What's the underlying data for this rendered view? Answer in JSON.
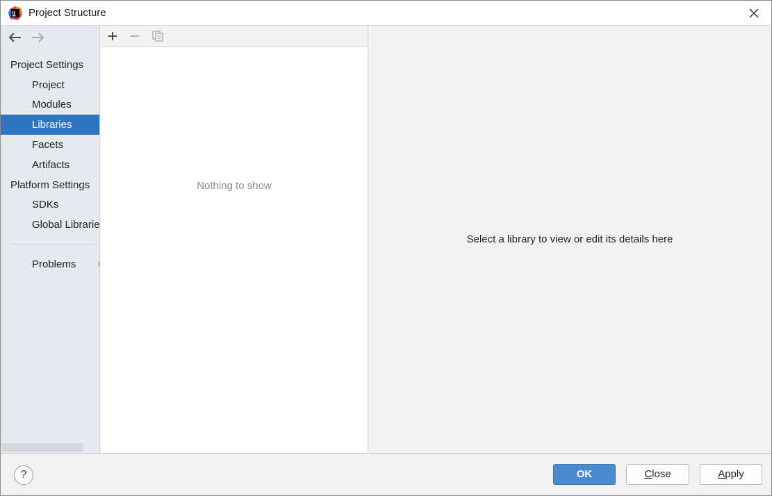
{
  "window": {
    "title": "Project Structure",
    "app_icon": "intellij-idea-icon",
    "close_icon": "close-icon"
  },
  "sidebar": {
    "nav": {
      "back_icon": "arrow-left-icon",
      "forward_icon": "arrow-right-icon"
    },
    "sections": [
      {
        "header": "Project Settings",
        "items": [
          {
            "label": "Project",
            "selected": false
          },
          {
            "label": "Modules",
            "selected": false
          },
          {
            "label": "Libraries",
            "selected": true
          },
          {
            "label": "Facets",
            "selected": false
          },
          {
            "label": "Artifacts",
            "selected": false
          }
        ]
      },
      {
        "header": "Platform Settings",
        "items": [
          {
            "label": "SDKs",
            "selected": false
          },
          {
            "label": "Global Libraries",
            "selected": false
          }
        ]
      }
    ],
    "problems": {
      "label": "Problems",
      "badge": "("
    }
  },
  "list_pane": {
    "toolbar": {
      "add_icon": "plus-icon",
      "remove_icon": "minus-icon",
      "copy_icon": "copy-icon"
    },
    "empty_text": "Nothing to show"
  },
  "details_pane": {
    "placeholder": "Select a library to view or edit its details here"
  },
  "footer": {
    "help_label": "?",
    "ok_label": "OK",
    "close_label_mnemonic": "C",
    "close_label_rest": "lose",
    "apply_label_mnemonic": "A",
    "apply_label_rest": "pply"
  },
  "colors": {
    "selection": "#2f74c0",
    "primary_button": "#4a8bd0",
    "sidebar_bg": "#e6eaee",
    "muted_text": "#8c8c8c"
  }
}
